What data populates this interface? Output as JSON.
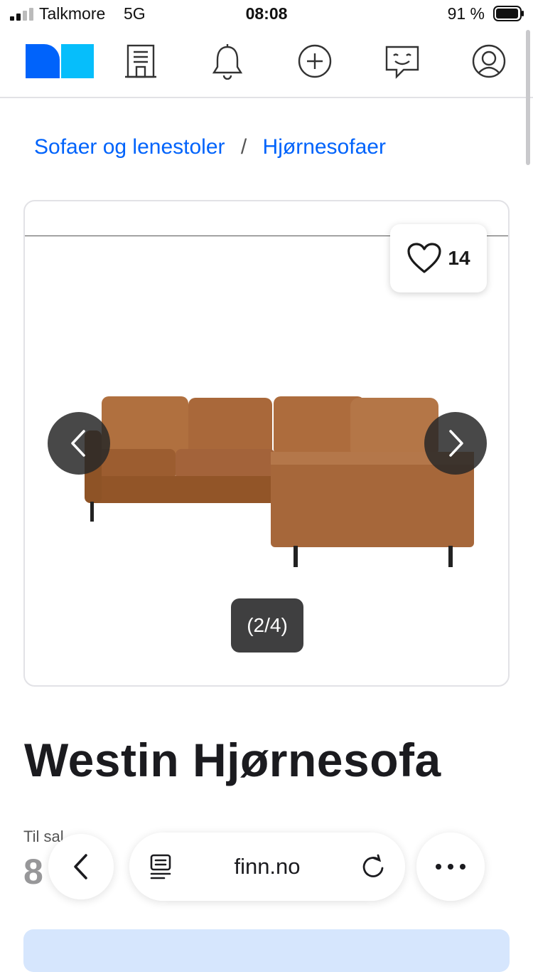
{
  "status_bar": {
    "carrier": "Talkmore",
    "network": "5G",
    "time": "08:08",
    "battery_percent": "91 %"
  },
  "nav": {
    "items": [
      "finn-logo",
      "company-icon",
      "bell-icon",
      "plus-circle-icon",
      "messages-icon",
      "profile-icon"
    ]
  },
  "breadcrumb": {
    "items": [
      "Sofaer og lenestoler",
      "Hjørnesofaer"
    ],
    "separator": "/"
  },
  "gallery": {
    "favorite_count": "14",
    "counter": "(2/4)"
  },
  "listing": {
    "title": "Westin Hjørnesofa",
    "sale_label": "Til sal",
    "price_partial": "8"
  },
  "browser": {
    "url": "finn.no"
  },
  "colors": {
    "link": "#0063fb",
    "logo_dark": "#0063fb",
    "logo_light": "#06befb",
    "sofa_leather": "#a9683a"
  }
}
